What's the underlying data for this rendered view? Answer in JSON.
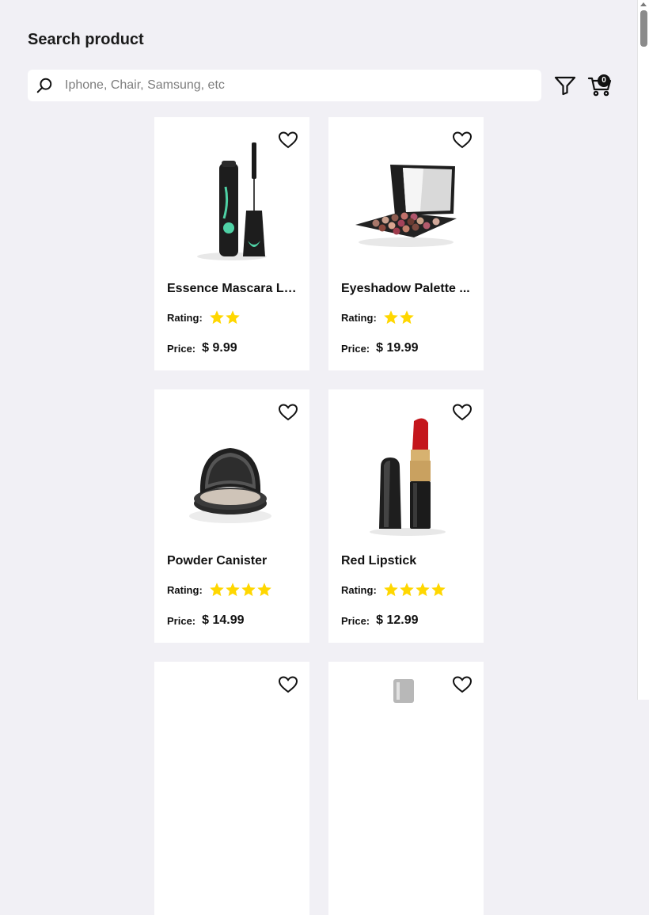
{
  "header": {
    "title": "Search product"
  },
  "search": {
    "placeholder": "Iphone, Chair, Samsung, etc",
    "value": ""
  },
  "toolbar": {
    "filter_icon": "filter-icon",
    "cart_icon": "cart-icon",
    "cart_count": "0"
  },
  "labels": {
    "rating": "Rating:",
    "price": "Price:"
  },
  "colors": {
    "background": "#f1f0f5",
    "star": "#ffd700",
    "card": "#ffffff"
  },
  "products": [
    {
      "name": "Essence Mascara La...",
      "rating": 2,
      "price": "$ 9.99"
    },
    {
      "name": "Eyeshadow Palette ...",
      "rating": 2,
      "price": "$ 19.99"
    },
    {
      "name": "Powder Canister",
      "rating": 4,
      "price": "$ 14.99"
    },
    {
      "name": "Red Lipstick",
      "rating": 4,
      "price": "$ 12.99"
    },
    {
      "name": "",
      "rating": 0,
      "price": ""
    },
    {
      "name": "",
      "rating": 0,
      "price": ""
    }
  ]
}
